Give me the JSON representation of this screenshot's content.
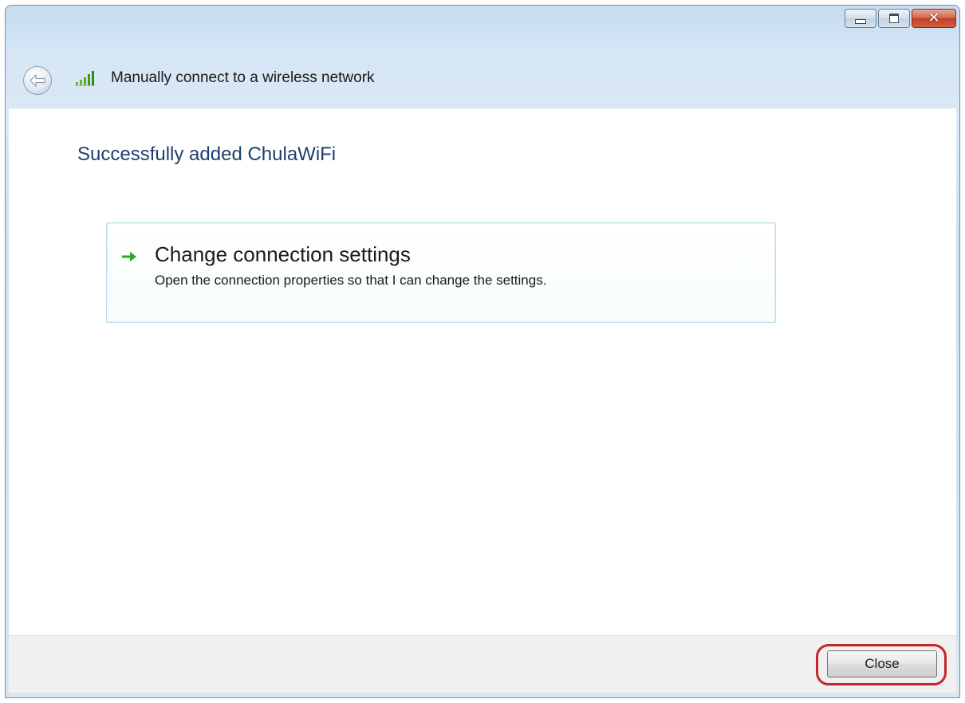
{
  "window": {
    "title": "Manually connect to a wireless network",
    "controls": {
      "minimize_icon": "minimize-icon",
      "maximize_icon": "maximize-icon",
      "close_icon": "close-icon"
    }
  },
  "header": {
    "back_icon": "back-arrow-icon",
    "network_icon": "wireless-signal-icon"
  },
  "main": {
    "heading": "Successfully added ChulaWiFi",
    "command_link": {
      "icon": "green-arrow-icon",
      "title": "Change connection settings",
      "description": "Open the connection properties so that I can change the settings."
    }
  },
  "footer": {
    "close_label": "Close",
    "highlight_color": "#c4262e"
  },
  "colors": {
    "heading": "#1e3f6b",
    "accent_arrow": "#2ea52e",
    "frame": "#d6e6f5"
  }
}
